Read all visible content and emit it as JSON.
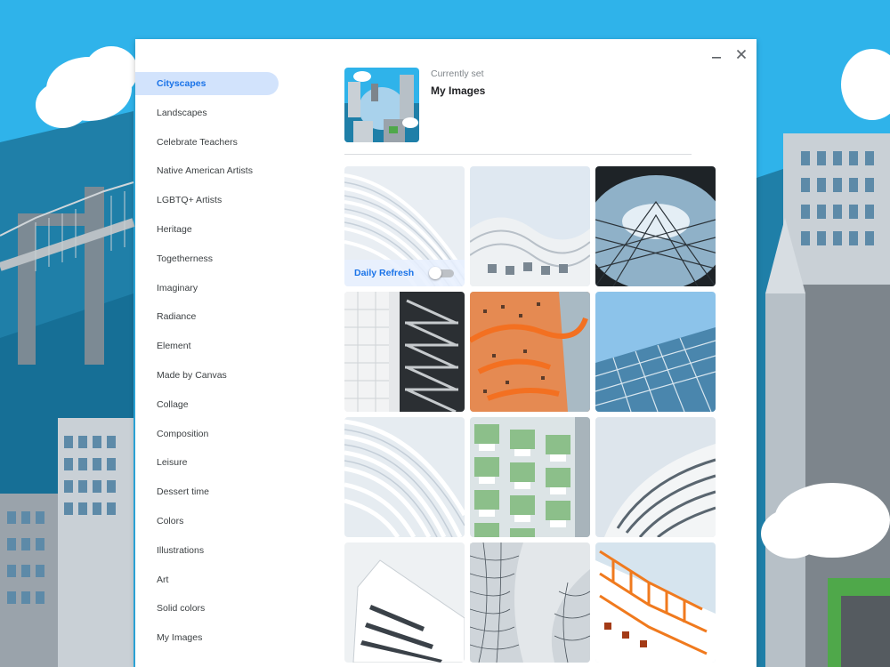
{
  "window": {
    "minimize_icon": "minimize-icon",
    "close_icon": "close-icon"
  },
  "sidebar": {
    "items": [
      {
        "label": "Cityscapes",
        "active": true
      },
      {
        "label": "Landscapes"
      },
      {
        "label": "Celebrate Teachers"
      },
      {
        "label": "Native American Artists"
      },
      {
        "label": "LGBTQ+ Artists"
      },
      {
        "label": "Heritage"
      },
      {
        "label": "Togetherness"
      },
      {
        "label": "Imaginary"
      },
      {
        "label": "Radiance"
      },
      {
        "label": "Element"
      },
      {
        "label": "Made by Canvas"
      },
      {
        "label": "Collage"
      },
      {
        "label": "Composition"
      },
      {
        "label": "Leisure"
      },
      {
        "label": "Dessert time"
      },
      {
        "label": "Colors"
      },
      {
        "label": "Illustrations"
      },
      {
        "label": "Art"
      },
      {
        "label": "Solid colors"
      },
      {
        "label": "My Images"
      }
    ]
  },
  "current": {
    "label": "Currently set",
    "name": "My Images"
  },
  "daily_refresh": {
    "label": "Daily Refresh",
    "enabled": false
  },
  "colors": {
    "accent": "#1a73e8",
    "active_bg": "#d2e3fc",
    "wallpaper_sky": "#2fb3ea"
  }
}
